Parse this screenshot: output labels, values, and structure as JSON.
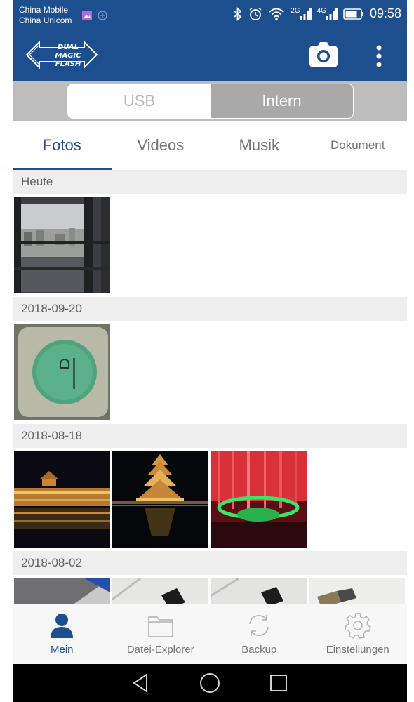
{
  "status_bar": {
    "carrier_1": "China Mobile",
    "carrier_2": "China Unicom",
    "net_2g": "2G",
    "net_4g": "4G",
    "time": "09:58"
  },
  "app_bar": {
    "logo_line1": "DUAL",
    "logo_line2": "MAGIC FLASH",
    "icons": [
      "camera-icon",
      "more-vert-icon"
    ]
  },
  "storage_toggle": {
    "options": [
      "USB",
      "Intern"
    ],
    "selected": "Intern"
  },
  "tabs": [
    {
      "label": "Fotos",
      "active": true
    },
    {
      "label": "Videos",
      "active": false
    },
    {
      "label": "Musik",
      "active": false
    },
    {
      "label": "Dokument",
      "active": false
    }
  ],
  "gallery": {
    "groups": [
      {
        "date": "Heute",
        "photo_count": 1
      },
      {
        "date": "2018-09-20",
        "photo_count": 1
      },
      {
        "date": "2018-08-18",
        "photo_count": 3
      },
      {
        "date": "2018-08-02",
        "photo_count": 4
      }
    ]
  },
  "bottom_nav": [
    {
      "label": "Mein",
      "icon": "person-icon",
      "active": true
    },
    {
      "label": "Datei-Explorer",
      "icon": "folder-icon",
      "active": false
    },
    {
      "label": "Backup",
      "icon": "sync-icon",
      "active": false
    },
    {
      "label": "Einstellungen",
      "icon": "gear-icon",
      "active": false
    }
  ],
  "colors": {
    "primary": "#1d4f8f",
    "toggle_selected": "#a9a9a9",
    "date_header": "#eeeeee"
  }
}
